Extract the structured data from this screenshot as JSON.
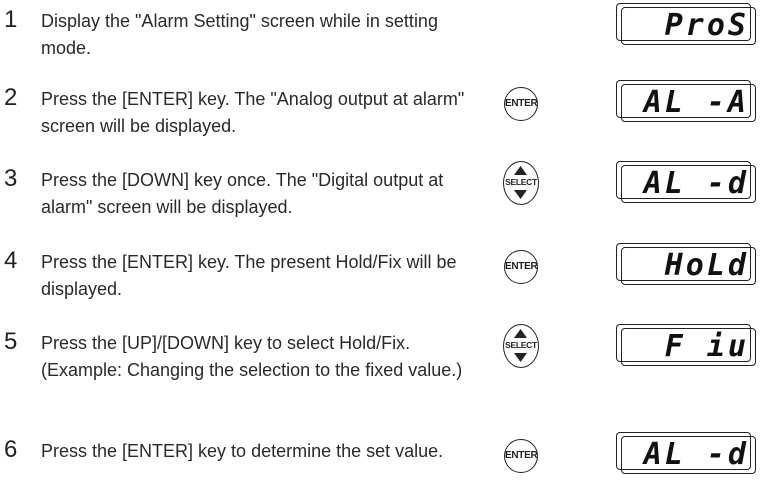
{
  "steps": [
    {
      "num": "1",
      "text": "Display the \"Alarm Setting\" screen while in setting mode.",
      "key": null,
      "display": "ProS"
    },
    {
      "num": "2",
      "text": "Press the [ENTER] key. The \"Analog output at alarm\" screen will be displayed.",
      "key": "ENTER",
      "display": "AL -A"
    },
    {
      "num": "3",
      "text": "Press the [DOWN] key once. The \"Digital output at alarm\" screen will be displayed.",
      "key": "SELECT",
      "display": "AL -d"
    },
    {
      "num": "4",
      "text": "Press the [ENTER] key. The present Hold/Fix will be displayed.",
      "key": "ENTER",
      "display": "HoLd"
    },
    {
      "num": "5",
      "text": "Press the [UP]/[DOWN] key to select Hold/Fix. (Example: Changing the selection to the fixed value.)",
      "key": "SELECT",
      "display": "F iu"
    },
    {
      "num": "6",
      "text": "Press the [ENTER] key to determine the set value.",
      "key": "ENTER",
      "display": "AL -d"
    }
  ]
}
